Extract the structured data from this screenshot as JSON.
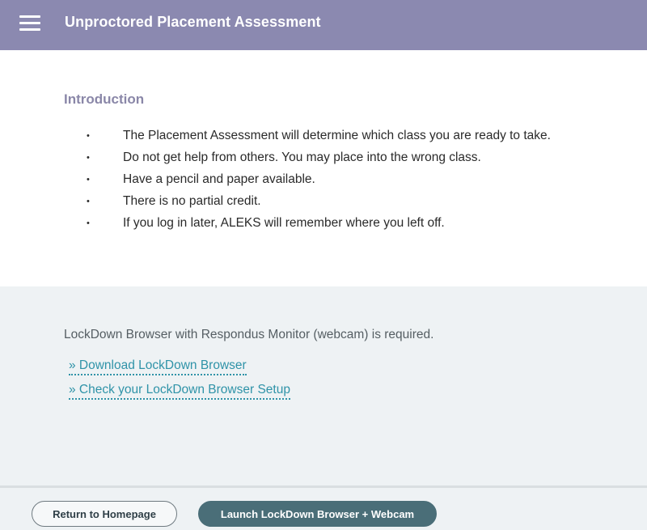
{
  "header": {
    "title": "Unproctored Placement Assessment",
    "menu_icon": "hamburger-menu-icon"
  },
  "intro": {
    "heading": "Introduction",
    "bullets": [
      "The Placement Assessment will determine which class you are ready to take.",
      "Do not get help from others. You may place into the wrong class.",
      "Have a pencil and paper available.",
      "There is no partial credit.",
      "If you log in later, ALEKS will remember where you left off."
    ]
  },
  "requirements": {
    "text": "LockDown Browser with Respondus Monitor (webcam) is required.",
    "download_link": "» Download LockDown Browser",
    "check_link": "» Check your LockDown Browser Setup"
  },
  "footer": {
    "return_button": "Return to Homepage",
    "launch_button": "Launch LockDown Browser + Webcam"
  },
  "colors": {
    "header_bg": "#8b89b0",
    "heading": "#8a87a8",
    "link": "#2f93a8",
    "section_bg": "#eef2f4",
    "launch_bg": "#4a6e78"
  }
}
